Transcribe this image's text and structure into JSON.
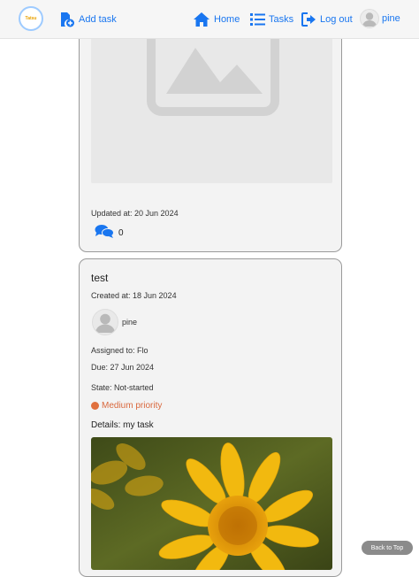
{
  "navbar": {
    "logo_text": "Tatsu",
    "add_task": "Add task",
    "home": "Home",
    "tasks": "Tasks",
    "logout": "Log out",
    "username": "pine",
    "accent": "#1976f0"
  },
  "task_prev": {
    "updated": "Updated at: 20 Jun 2024",
    "comments": "0"
  },
  "task": {
    "title": "test",
    "created": "Created at: 18 Jun 2024",
    "owner": "pine",
    "assigned": "Assigned to: Flo",
    "due": "Due: 27 Jun 2024",
    "state": "State: Not-started",
    "priority": "Medium priority",
    "priority_color": "#e0703e",
    "details": "Details: my task"
  },
  "back_to_top": "Back to Top",
  "icons": [
    "file-plus-icon",
    "home-icon",
    "list-icon",
    "logout-icon",
    "user-avatar-icon",
    "comments-icon",
    "image-placeholder-icon"
  ]
}
